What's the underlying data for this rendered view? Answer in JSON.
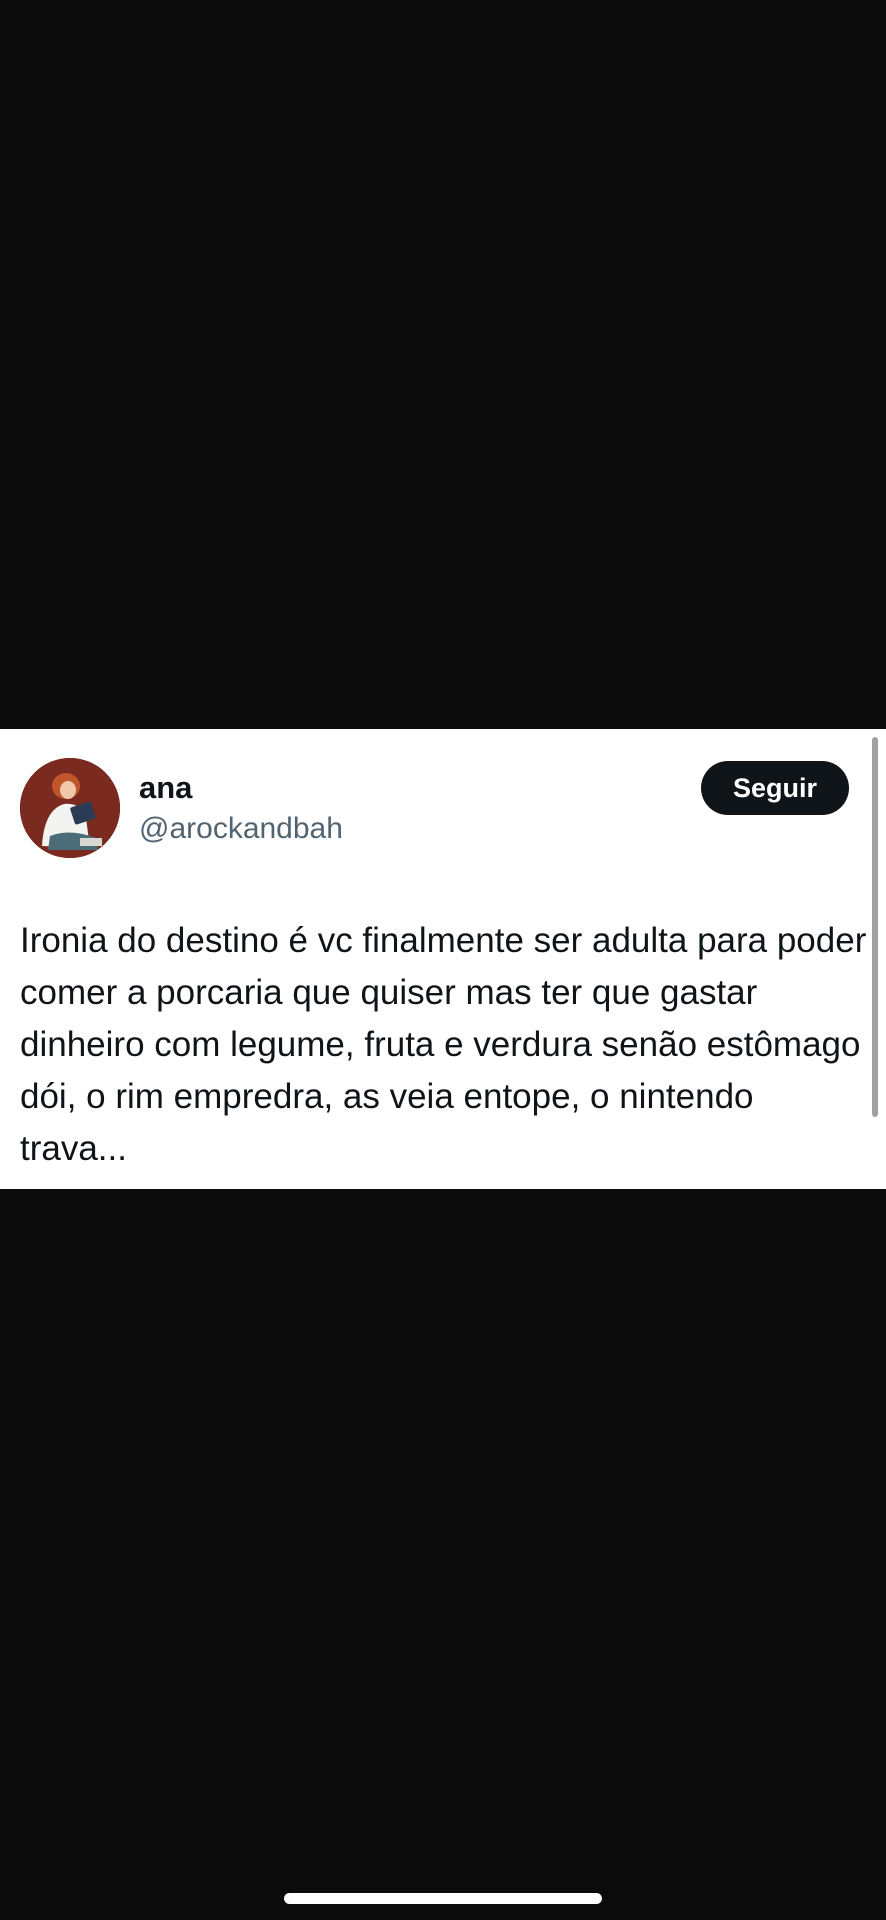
{
  "tweet": {
    "author": {
      "display_name": "ana",
      "handle": "@arockandbah"
    },
    "follow_label": "Seguir",
    "text": "Ironia do destino é vc finalmente ser adulta para poder comer a porcaria que quiser mas ter que gastar dinheiro com legume, fruta e verdura senão estômago dói, o rim empredra, as veia entope, o nintendo trava..."
  },
  "icons": {
    "avatar": "profile-photo"
  },
  "colors": {
    "background": "#0b0b0b",
    "card": "#ffffff",
    "text_primary": "#0f1419",
    "text_secondary": "#536471",
    "button_bg": "#0f1419"
  }
}
